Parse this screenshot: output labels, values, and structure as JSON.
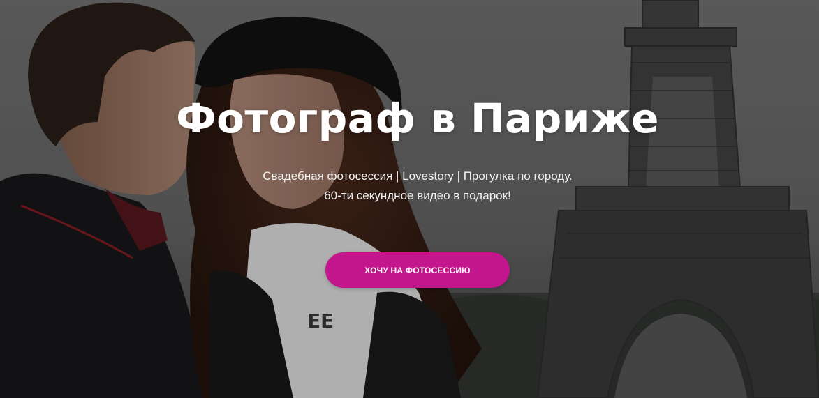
{
  "hero": {
    "title": "Фотограф в Париже",
    "subtitle_line1": "Свадебная фотосессия | Lovestory | Прогулка по городу.",
    "subtitle_line2": "60-ти секундное видео в подарок!",
    "cta_label": "ХОЧУ НА ФОТОСЕССИЮ"
  },
  "colors": {
    "accent": "#c4168c",
    "text": "#ffffff"
  }
}
